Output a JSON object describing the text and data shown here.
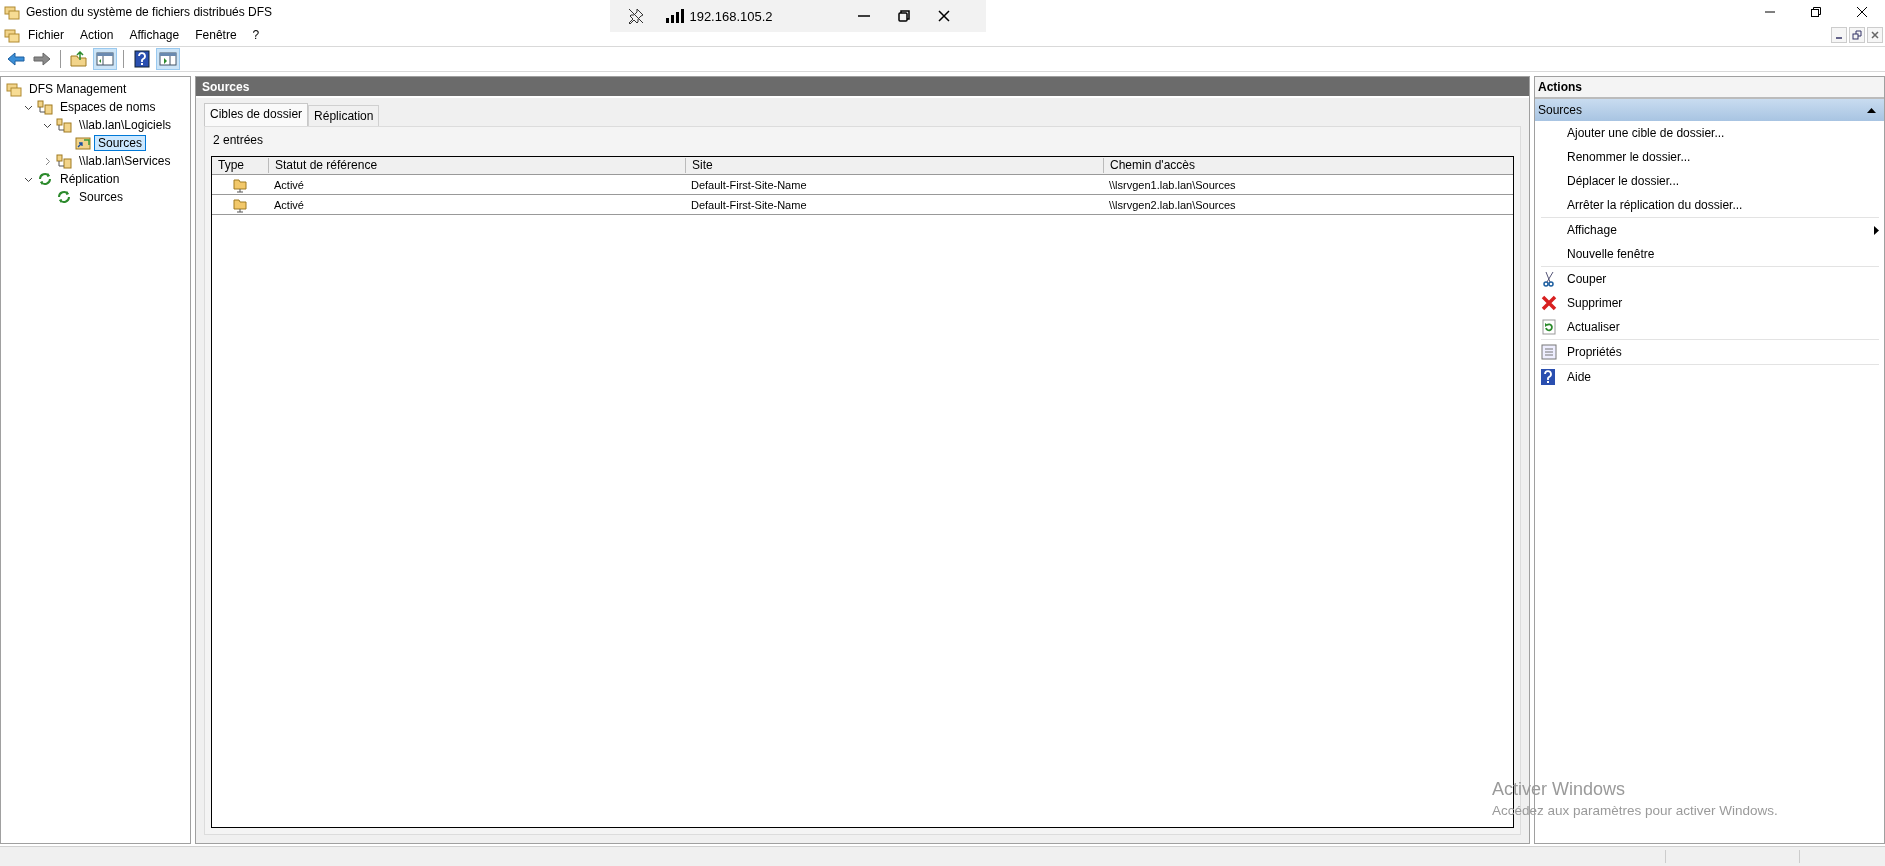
{
  "window": {
    "title": "Gestion du système de fichiers distribués DFS"
  },
  "remote_bar": {
    "address": "192.168.105.2"
  },
  "menu": [
    {
      "label": "Fichier"
    },
    {
      "label": "Action"
    },
    {
      "label": "Affichage"
    },
    {
      "label": "Fenêtre"
    },
    {
      "label": "?"
    }
  ],
  "toolbar": [
    {
      "kind": "back",
      "on": false
    },
    {
      "kind": "forward",
      "on": false
    },
    {
      "kind": "separator"
    },
    {
      "kind": "up",
      "on": false
    },
    {
      "kind": "tree-toggle",
      "on": true
    },
    {
      "kind": "separator"
    },
    {
      "kind": "help",
      "on": false
    },
    {
      "kind": "actions-toggle",
      "on": true
    }
  ],
  "tree": [
    {
      "label": "DFS Management",
      "kind": "root",
      "selected": false,
      "children": [
        {
          "label": "Espaces de noms",
          "kind": "namespaces",
          "expanded": true,
          "selected": false,
          "children": [
            {
              "label": "\\\\lab.lan\\Logiciels",
              "kind": "namespace",
              "expanded": true,
              "selected": false,
              "children": [
                {
                  "label": "Sources",
                  "kind": "folder",
                  "selected": true
                }
              ]
            },
            {
              "label": "\\\\lab.lan\\Services",
              "kind": "namespace",
              "expanded": false,
              "selected": false
            }
          ]
        },
        {
          "label": "Réplication",
          "kind": "replication",
          "expanded": true,
          "selected": false,
          "children": [
            {
              "label": "Sources",
              "kind": "group",
              "selected": false
            }
          ]
        }
      ]
    }
  ],
  "content": {
    "title": "Sources",
    "tabs": [
      {
        "label": "Cibles de dossier",
        "selected": true
      },
      {
        "label": "Réplication",
        "selected": false
      }
    ],
    "count": "2 entrées",
    "table": {
      "columns": [
        "Type",
        "Statut de référence",
        "Site",
        "Chemin d'accès"
      ],
      "rows": [
        [
          "",
          "Activé",
          "Default-First-Site-Name",
          "\\\\lsrvgen1.lab.lan\\Sources"
        ],
        [
          "",
          "Activé",
          "Default-First-Site-Name",
          "\\\\lsrvgen2.lab.lan\\Sources"
        ]
      ]
    }
  },
  "actions": {
    "title": "Actions",
    "section": {
      "label": "Sources",
      "expanded": true
    },
    "groups": [
      [
        {
          "label": "Ajouter une cible de dossier...",
          "kind": "plain"
        },
        {
          "label": "Renommer le dossier...",
          "kind": "plain"
        },
        {
          "label": "Déplacer le dossier...",
          "kind": "plain"
        },
        {
          "label": "Arrêter la réplication du dossier...",
          "kind": "plain"
        }
      ],
      [
        {
          "label": "Affichage",
          "kind": "submenu"
        },
        {
          "label": "Nouvelle fenêtre",
          "kind": "plain"
        }
      ],
      [
        {
          "label": "Couper",
          "kind": "cut"
        },
        {
          "label": "Supprimer",
          "kind": "delete"
        },
        {
          "label": "Actualiser",
          "kind": "refresh"
        }
      ],
      [
        {
          "label": "Propriétés",
          "kind": "properties"
        }
      ],
      [
        {
          "label": "Aide",
          "kind": "help"
        }
      ]
    ]
  },
  "activation_notice": {
    "title": "Activer Windows",
    "text": "Accédez aux paramètres pour activer Windows."
  }
}
